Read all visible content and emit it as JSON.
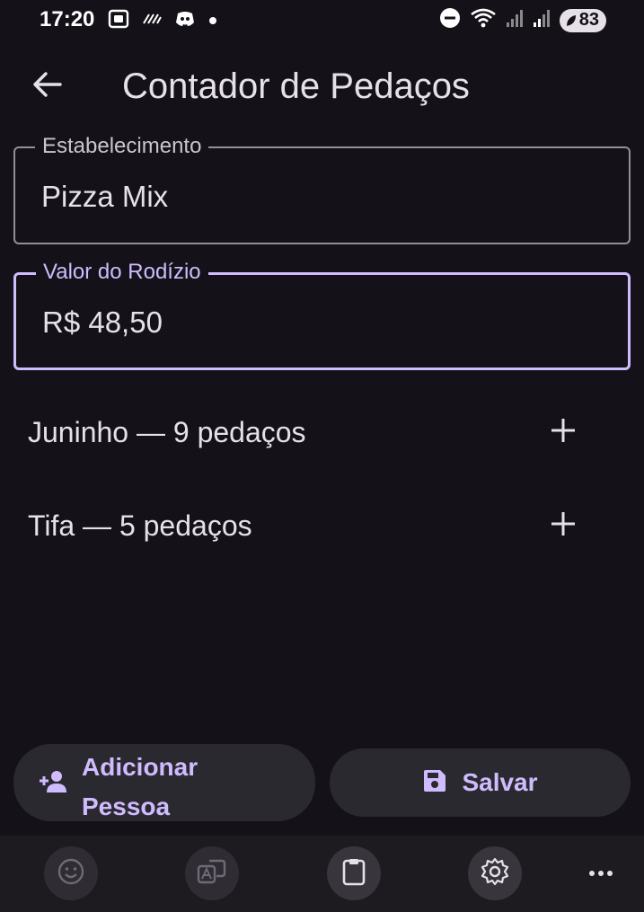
{
  "status_bar": {
    "time": "17:20",
    "battery": "83",
    "left_icons": [
      "screenshot-icon",
      "stripes-icon",
      "discord-icon",
      "dot-icon"
    ],
    "right_icons": [
      "do-not-disturb-icon",
      "wifi-icon",
      "signal-icon",
      "signal-icon",
      "battery-icon"
    ]
  },
  "app_bar": {
    "back_icon": "arrow-back-icon",
    "title": "Contador de Pedaços"
  },
  "form": {
    "establishment": {
      "label": "Estabelecimento",
      "value": "Pizza Mix"
    },
    "price": {
      "label": "Valor do Rodízio",
      "value": "R$ 48,50"
    }
  },
  "people": [
    {
      "label": "Juninho — 9 pedaços",
      "count": 9,
      "add_icon": "plus-icon"
    },
    {
      "label": "Tifa — 5 pedaços",
      "count": 5,
      "add_icon": "plus-icon"
    }
  ],
  "actions": {
    "add_person": {
      "label": "Adicionar Pessoa",
      "icon": "person-add-icon"
    },
    "save": {
      "label": "Salvar",
      "icon": "save-icon"
    }
  },
  "nav_bar": {
    "items": [
      "emoji-icon",
      "translate-icon",
      "clipboard-icon",
      "settings-icon",
      "more-icon"
    ]
  },
  "colors": {
    "background": "#141218",
    "accent": "#cfbcff",
    "outline": "#938f99",
    "button_bg": "#2b2930"
  }
}
